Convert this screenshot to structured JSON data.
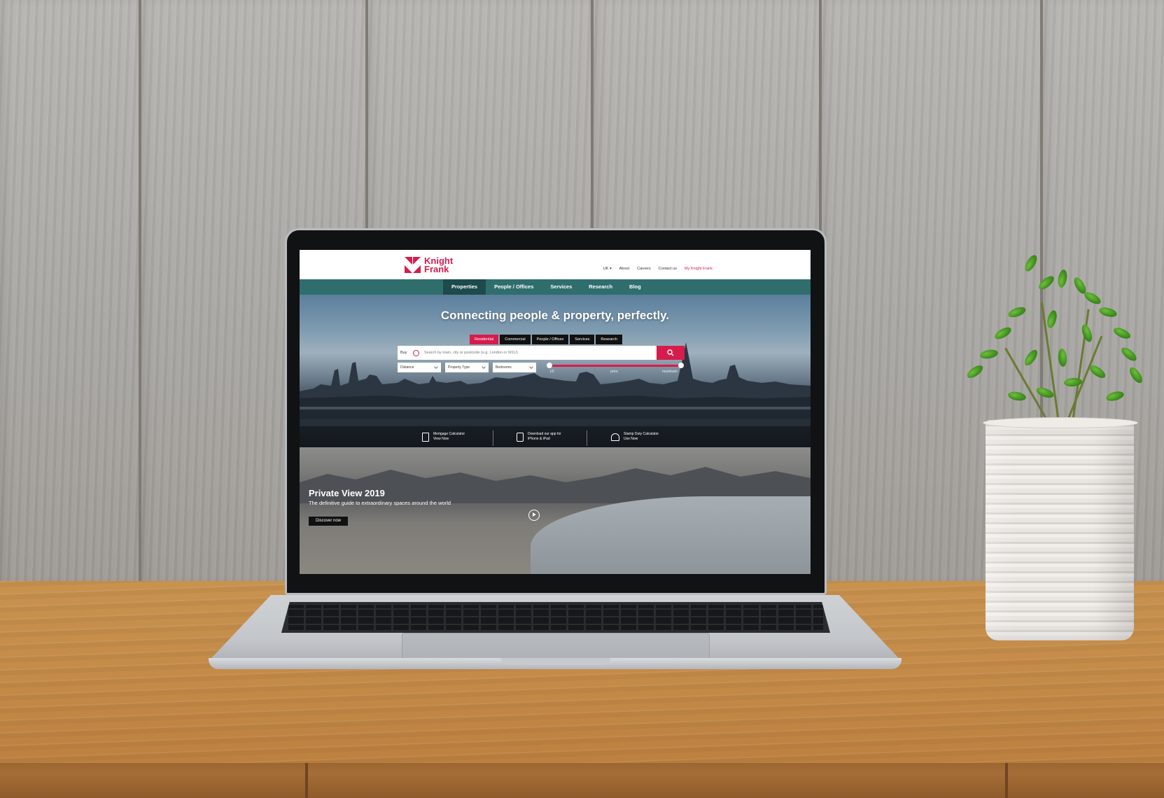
{
  "site": {
    "logo_line1": "Knight",
    "logo_line2": "Frank"
  },
  "utility_nav": {
    "items": [
      "UK ▾",
      "About",
      "Careers",
      "Contact us",
      "My Knight Frank"
    ]
  },
  "main_nav": {
    "items": [
      "Properties",
      "People / Offices",
      "Services",
      "Research",
      "Blog"
    ],
    "active": "Properties"
  },
  "hero": {
    "title": "Connecting people & property, perfectly.",
    "tabs": [
      "Residential",
      "Commercial",
      "People / Offices",
      "Services",
      "Research"
    ],
    "active_tab": "Residential",
    "search": {
      "mode": "Buy",
      "placeholder": "Search by town, city or postcode (e.g. London or W1U)"
    },
    "filters": [
      "Distance",
      "Property Type",
      "Bedrooms"
    ],
    "price": {
      "min_label": "£0",
      "center_label": "price",
      "max_label": "maximum"
    },
    "promos": [
      {
        "line1": "Mortgage Calculator",
        "line2": "View Now"
      },
      {
        "line1": "Download our app for",
        "line2": "iPhone & iPad"
      },
      {
        "line1": "Stamp Duty Calculator",
        "line2": "Use Now"
      }
    ]
  },
  "feature": {
    "title": "Private View 2019",
    "subtitle": "The definitive guide to extraordinary spaces around the world",
    "cta": "Discover now"
  },
  "colors": {
    "brand_red": "#d71c4c",
    "nav_teal": "#2f6e6d",
    "nav_active": "#1d4a4a"
  }
}
